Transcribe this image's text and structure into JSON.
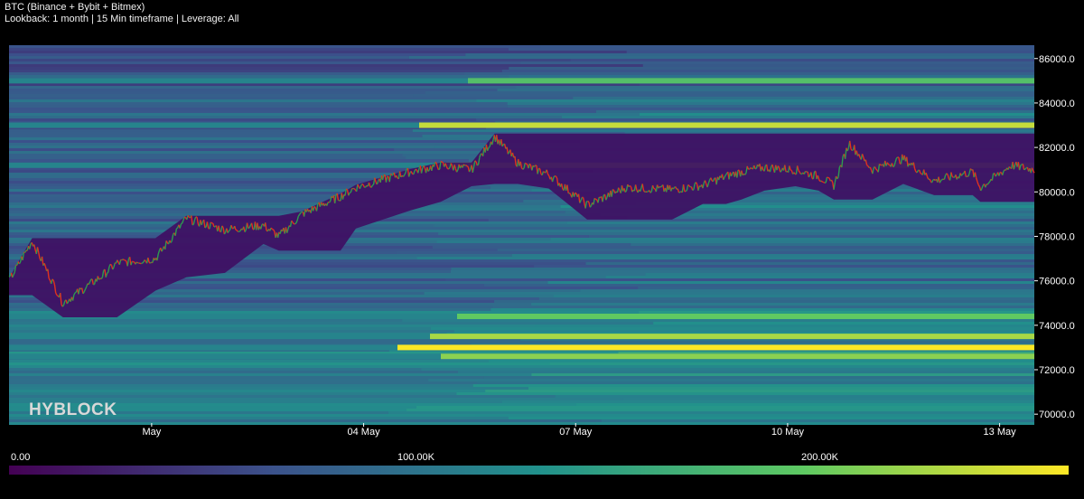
{
  "header": {
    "title": "BTC (Binance + Bybit + Bitmex)",
    "subtitle": "Lookback: 1 month | 15 Min timeframe | Leverage: All"
  },
  "watermark": "HYBLOCK",
  "colors": {
    "background": "#000000",
    "candle_up": "#2e9b4f",
    "candle_down": "#e0321e",
    "colormap": [
      "#440154",
      "#3b528b",
      "#21918c",
      "#5ec962",
      "#fde725"
    ]
  },
  "chart_data": {
    "type": "heatmap",
    "title": "BTC (Binance + Bybit + Bitmex)",
    "subtitle": "Lookback: 1 month | 15 Min timeframe | Leverage: All",
    "x_tick_labels": [
      "May",
      "04 May",
      "07 May",
      "10 May",
      "13 May"
    ],
    "y_tick_labels": [
      "86000.0",
      "84000.0",
      "82000.0",
      "80000.0",
      "78000.0",
      "76000.0",
      "74000.0",
      "72000.0",
      "70000.0"
    ],
    "ylim": [
      69600,
      86600
    ],
    "y_axis_side": "right",
    "colorbar": {
      "range": [
        0,
        240000
      ],
      "tick_labels": [
        "0.00",
        "100.00K",
        "200.00K"
      ]
    },
    "price_path": {
      "time_days": [
        0,
        0.3,
        0.7,
        1.2,
        1.4,
        1.9,
        2.3,
        2.8,
        3.3,
        3.5,
        3.8,
        4.3,
        4.5,
        5.2,
        5.6,
        6.0,
        6.3,
        6.6,
        7.0,
        7.5,
        8.0,
        8.6,
        9.0,
        9.3,
        9.5,
        9.8,
        10.2,
        10.5,
        10.7,
        10.9,
        11.2,
        11.6,
        12.0,
        12.5,
        12.6,
        13.0,
        13.3
      ],
      "price": [
        76000,
        77800,
        75000,
        76200,
        76800,
        77000,
        78800,
        78300,
        78500,
        78000,
        79000,
        79800,
        80200,
        80900,
        81200,
        81000,
        82500,
        81300,
        80800,
        79400,
        80200,
        80100,
        80300,
        80700,
        80900,
        81100,
        81000,
        80700,
        80300,
        82200,
        81000,
        81500,
        80500,
        80900,
        80200,
        81200,
        81000
      ]
    },
    "liquidation_bands": [
      {
        "price": 83000,
        "intensity": 0.8
      },
      {
        "price": 81200,
        "intensity": 0.55
      },
      {
        "price": 73500,
        "intensity": 0.7
      },
      {
        "price": 73000,
        "intensity": 1.0
      },
      {
        "price": 72600,
        "intensity": 0.6
      },
      {
        "price": 74400,
        "intensity": 0.45
      },
      {
        "price": 85000,
        "intensity": 0.35
      }
    ]
  }
}
